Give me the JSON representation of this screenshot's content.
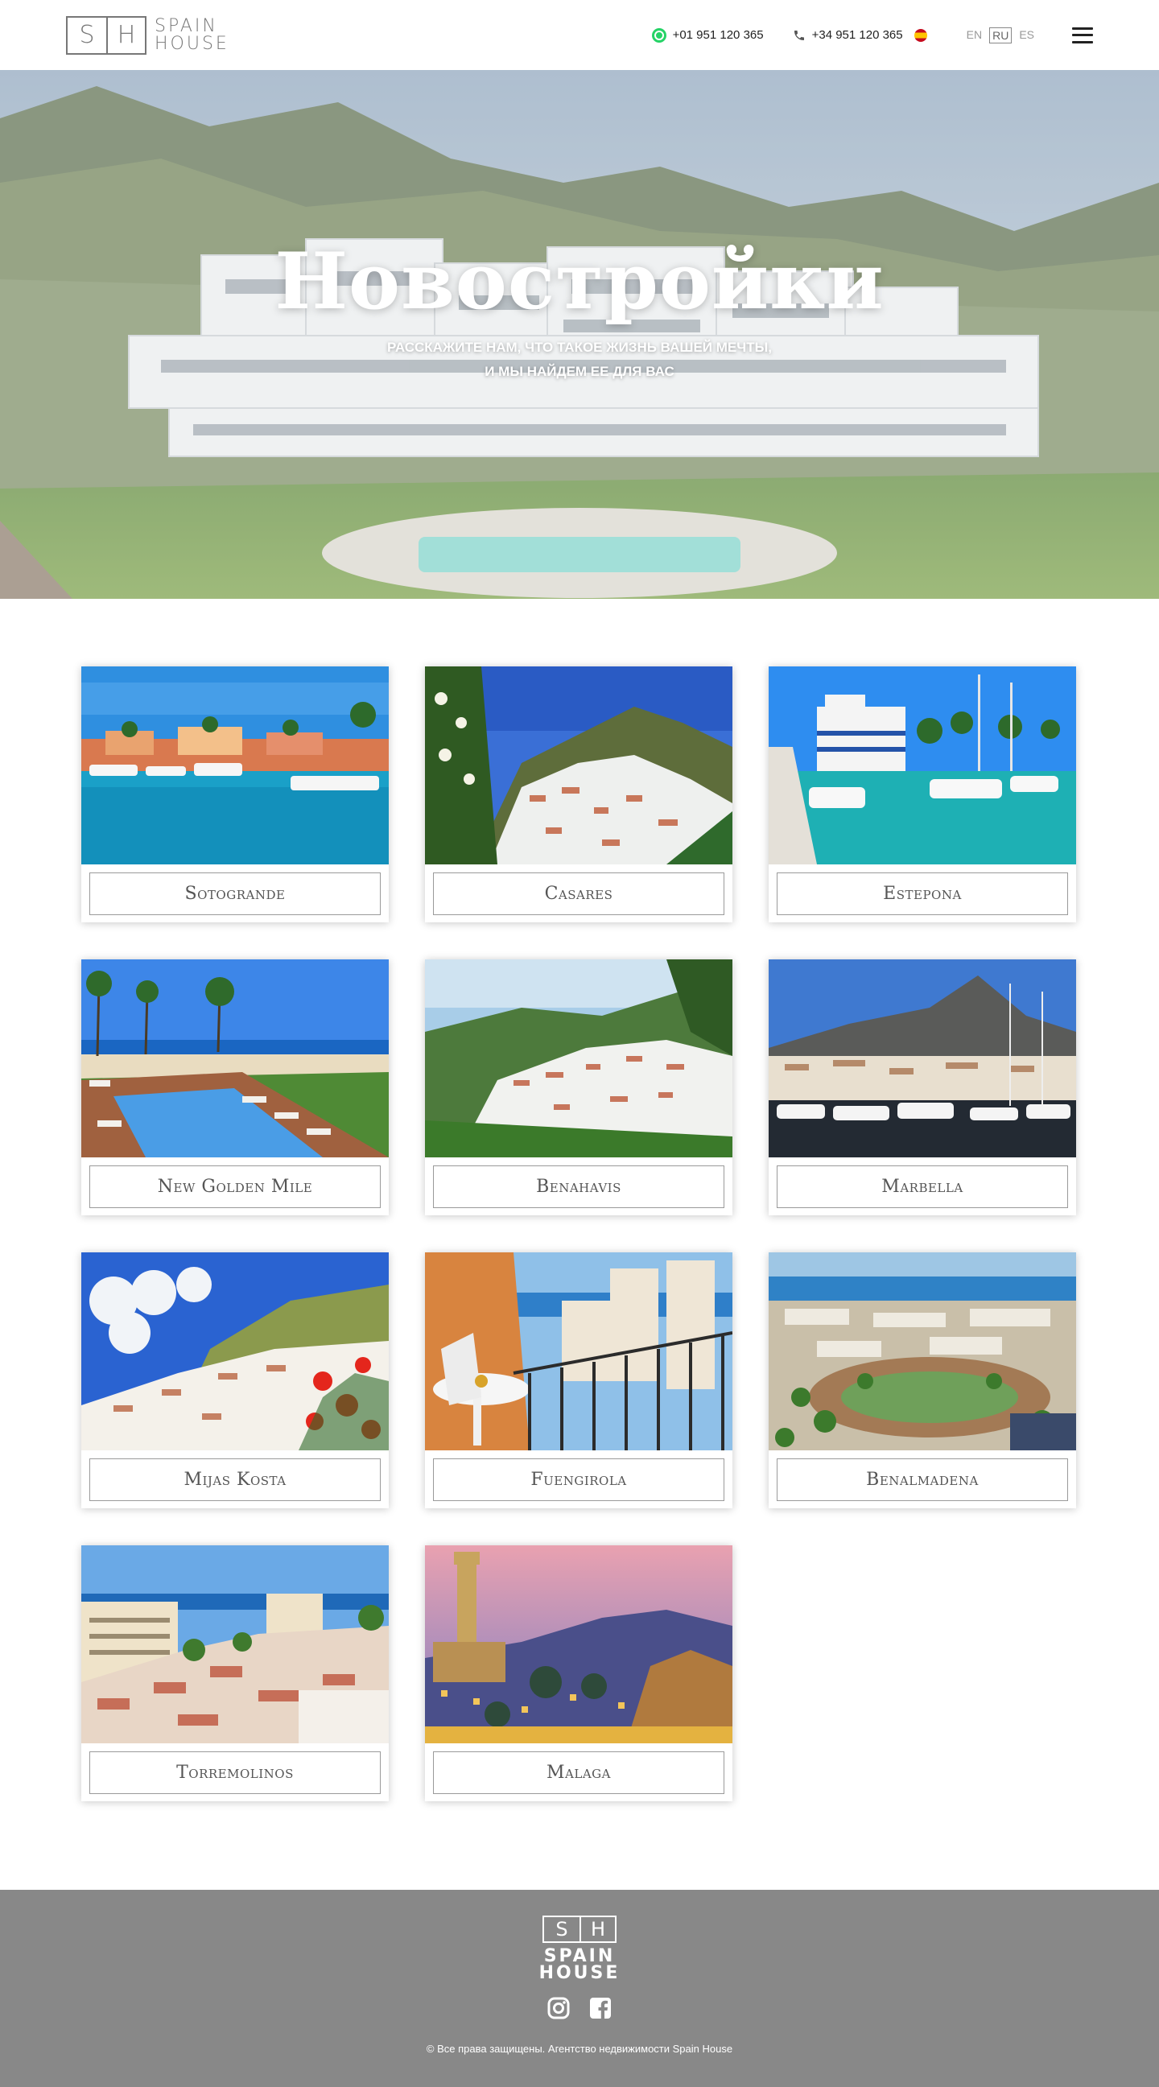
{
  "brand": {
    "logo_letters": [
      "S",
      "H"
    ],
    "logo_word1": "SPAIN",
    "logo_word2": "HOUSE"
  },
  "header": {
    "phone_whatsapp": "+01 951 120 365",
    "phone_es": "+34 951 120 365",
    "languages": [
      "EN",
      "RU",
      "ES"
    ],
    "active_language": "RU"
  },
  "hero": {
    "title": "Новостройки",
    "subtitle_line1": "Расскажите нам, что такое жизнь вашей мечты,",
    "subtitle_line2": "и мы найдем ее для вас"
  },
  "locations": [
    {
      "label": "Sotogrande",
      "scene": "marina"
    },
    {
      "label": "Casares",
      "scene": "hillvillage"
    },
    {
      "label": "Estepona",
      "scene": "port"
    },
    {
      "label": "New Golden Mile",
      "scene": "pool"
    },
    {
      "label": "Benahavis",
      "scene": "valley"
    },
    {
      "label": "Marbella",
      "scene": "yachts"
    },
    {
      "label": "Mijas Kosta",
      "scene": "flowers"
    },
    {
      "label": "Fuengirola",
      "scene": "balcony"
    },
    {
      "label": "Benalmadena",
      "scene": "aerial"
    },
    {
      "label": "Torremolinos",
      "scene": "town"
    },
    {
      "label": "Malaga",
      "scene": "dusk"
    }
  ],
  "footer": {
    "copyright": "© Все права защищены. Агентство недвижимости Spain House",
    "socials": [
      "instagram-icon",
      "facebook-icon"
    ]
  },
  "colors": {
    "footer_bg": "#888888",
    "whatsapp": "#25D366"
  }
}
